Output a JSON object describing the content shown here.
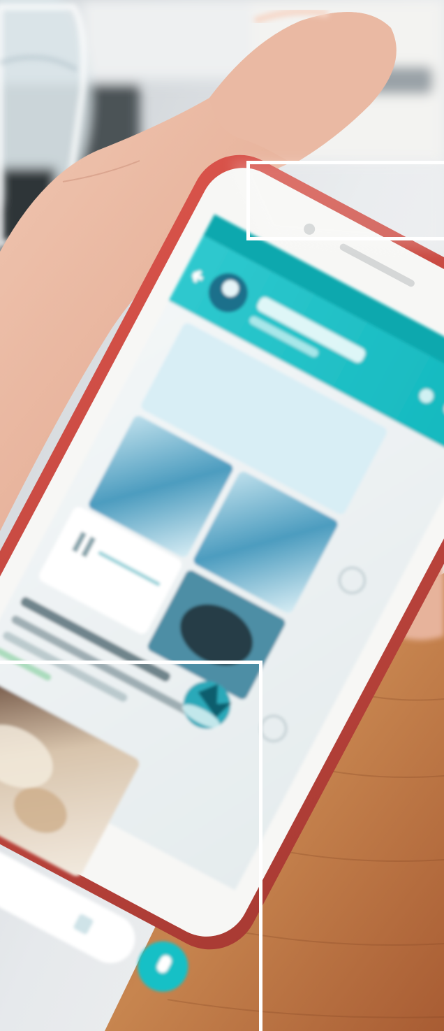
{
  "scene": {
    "subject": "hand-holding-smartphone",
    "colors": {
      "accent_teal": "#19c1c6",
      "phone_case_red": "#c9403a",
      "table_wood": "#b4683e",
      "frame_white": "#ffffff"
    }
  },
  "phone_screen": {
    "app_bar_icons": [
      "back-arrow-icon",
      "avatar-icon"
    ],
    "chat_items": [
      "media-thumbnail",
      "media-thumbnail",
      "media-thumbnail",
      "media-thumbnail",
      "voice-message",
      "sticker",
      "photo-message"
    ],
    "fab_icon": "mic-icon"
  },
  "overlays": {
    "frames": [
      "highlight-frame-top",
      "highlight-frame-bottom"
    ]
  }
}
